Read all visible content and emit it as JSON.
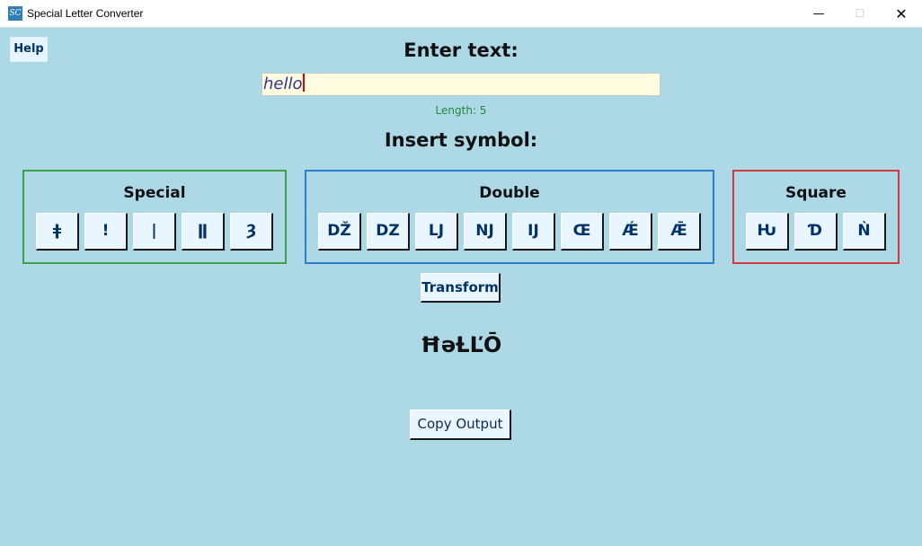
{
  "window": {
    "title": "Special Letter Converter",
    "icon_text": "SC",
    "minimize": "—",
    "maximize": "☐",
    "close": "✕"
  },
  "help_label": "Help",
  "input": {
    "label": "Enter text:",
    "value": "hello",
    "length_text": "Length: 5"
  },
  "insert_label": "Insert symbol:",
  "groups": {
    "special": {
      "title": "Special",
      "symbols": [
        "ǂ",
        "!",
        "|",
        "ǁ",
        "Ȝ"
      ]
    },
    "double": {
      "title": "Double",
      "symbols": [
        "DŽ",
        "DZ",
        "LJ",
        "NJ",
        "IJ",
        "Œ",
        "Ǽ",
        "Ǣ"
      ]
    },
    "square": {
      "title": "Square",
      "symbols": [
        "Ƕ",
        "Ɗ",
        "Ǹ"
      ]
    }
  },
  "transform_label": "Transform",
  "output_text": "ĦəȽĽŌ",
  "copy_label": "Copy Output",
  "colors": {
    "background": "#add8e6",
    "special_border": "#3aa04a",
    "double_border": "#2a7fcf",
    "square_border": "#d23a3a"
  }
}
